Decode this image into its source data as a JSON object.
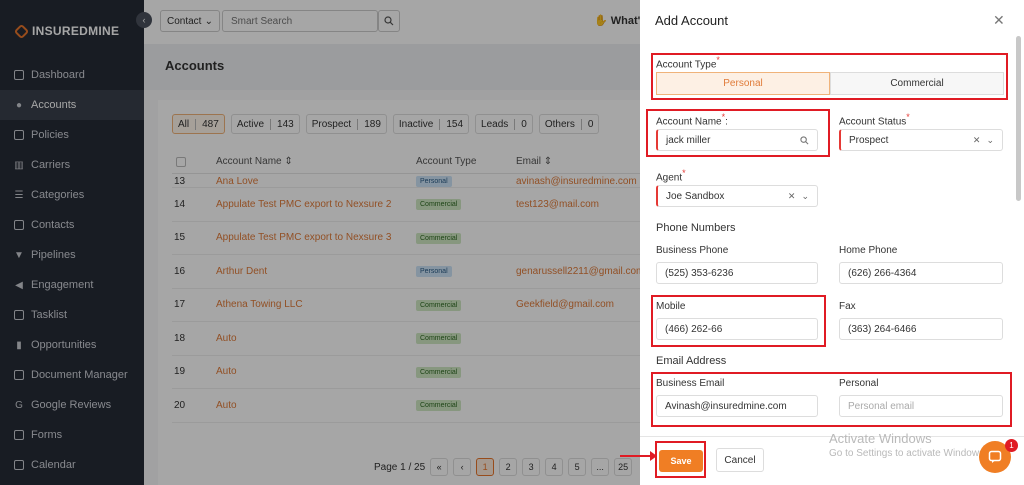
{
  "brand": {
    "name": "INSUREDMINE"
  },
  "sidebar": {
    "items": [
      {
        "label": "Dashboard",
        "icon": "dashboard-icon"
      },
      {
        "label": "Accounts",
        "icon": "accounts-icon",
        "active": true
      },
      {
        "label": "Policies",
        "icon": "policies-icon"
      },
      {
        "label": "Carriers",
        "icon": "carriers-icon"
      },
      {
        "label": "Categories",
        "icon": "categories-icon"
      },
      {
        "label": "Contacts",
        "icon": "contacts-icon"
      },
      {
        "label": "Pipelines",
        "icon": "pipelines-icon"
      },
      {
        "label": "Engagement",
        "icon": "engagement-icon"
      },
      {
        "label": "Tasklist",
        "icon": "tasklist-icon"
      },
      {
        "label": "Opportunities",
        "icon": "opportunities-icon"
      },
      {
        "label": "Document Manager",
        "icon": "document-manager-icon"
      },
      {
        "label": "Google Reviews",
        "icon": "google-reviews-icon"
      },
      {
        "label": "Forms",
        "icon": "forms-icon"
      },
      {
        "label": "Calendar",
        "icon": "calendar-icon"
      }
    ]
  },
  "topbar": {
    "contact_select": "Contact",
    "search_placeholder": "Smart Search",
    "whats_new": "What's"
  },
  "page": {
    "title": "Accounts"
  },
  "filters": [
    {
      "label": "All",
      "count": "487",
      "active": true
    },
    {
      "label": "Active",
      "count": "143"
    },
    {
      "label": "Prospect",
      "count": "189"
    },
    {
      "label": "Inactive",
      "count": "154"
    },
    {
      "label": "Leads",
      "count": "0"
    },
    {
      "label": "Others",
      "count": "0"
    }
  ],
  "table": {
    "headers": {
      "name": "Account Name",
      "type": "Account Type",
      "email": "Email"
    },
    "partial_row": {
      "no": "13",
      "name": "Ana Love",
      "type": "Personal",
      "email": "avinash@insuredmine.com"
    },
    "rows": [
      {
        "no": "14",
        "name": "Appulate Test PMC export to Nexsure 2",
        "type": "Commercial",
        "email": "test123@mail.com"
      },
      {
        "no": "15",
        "name": "Appulate Test PMC export to Nexsure 3",
        "type": "Commercial",
        "email": ""
      },
      {
        "no": "16",
        "name": "Arthur Dent",
        "type": "Personal",
        "email": "genarussell2211@gmail.com"
      },
      {
        "no": "17",
        "name": "Athena Towing LLC",
        "type": "Commercial",
        "email": "Geekfield@gmail.com"
      },
      {
        "no": "18",
        "name": "Auto",
        "type": "Commercial",
        "email": ""
      },
      {
        "no": "19",
        "name": "Auto",
        "type": "Commercial",
        "email": ""
      },
      {
        "no": "20",
        "name": "Auto",
        "type": "Commercial",
        "email": ""
      }
    ]
  },
  "pagination": {
    "label": "Page 1 / 25",
    "first": "«",
    "prev": "‹",
    "pages": [
      "1",
      "2",
      "3",
      "4",
      "5",
      "...",
      "25"
    ],
    "current": "1"
  },
  "modal": {
    "title": "Add Account",
    "account_type_label": "Account Type",
    "account_type_options": [
      "Personal",
      "Commercial"
    ],
    "account_type_selected": "Personal",
    "account_name_label": "Account Name",
    "account_name_value": "jack miller",
    "account_status_label": "Account Status",
    "account_status_value": "Prospect",
    "agent_label": "Agent",
    "agent_value": "Joe Sandbox",
    "phone_section": "Phone Numbers",
    "business_phone_label": "Business Phone",
    "business_phone_value": "(525) 353-6236",
    "home_phone_label": "Home Phone",
    "home_phone_value": "(626) 266-4364",
    "mobile_label": "Mobile",
    "mobile_value": "(466) 262-66",
    "fax_label": "Fax",
    "fax_value": "(363) 264-6466",
    "email_section": "Email Address",
    "business_email_label": "Business Email",
    "business_email_value": "Avinash@insuredmine.com",
    "personal_email_label": "Personal",
    "personal_email_placeholder": "Personal email",
    "save_label": "Save",
    "cancel_label": "Cancel"
  },
  "watermark": {
    "line1": "Activate Windows",
    "line2": "Go to Settings to activate Windows."
  },
  "chat": {
    "badge": "1"
  },
  "colors": {
    "accent": "#f07e24",
    "sidebar": "#262b36",
    "highlight": "#e01b24"
  }
}
